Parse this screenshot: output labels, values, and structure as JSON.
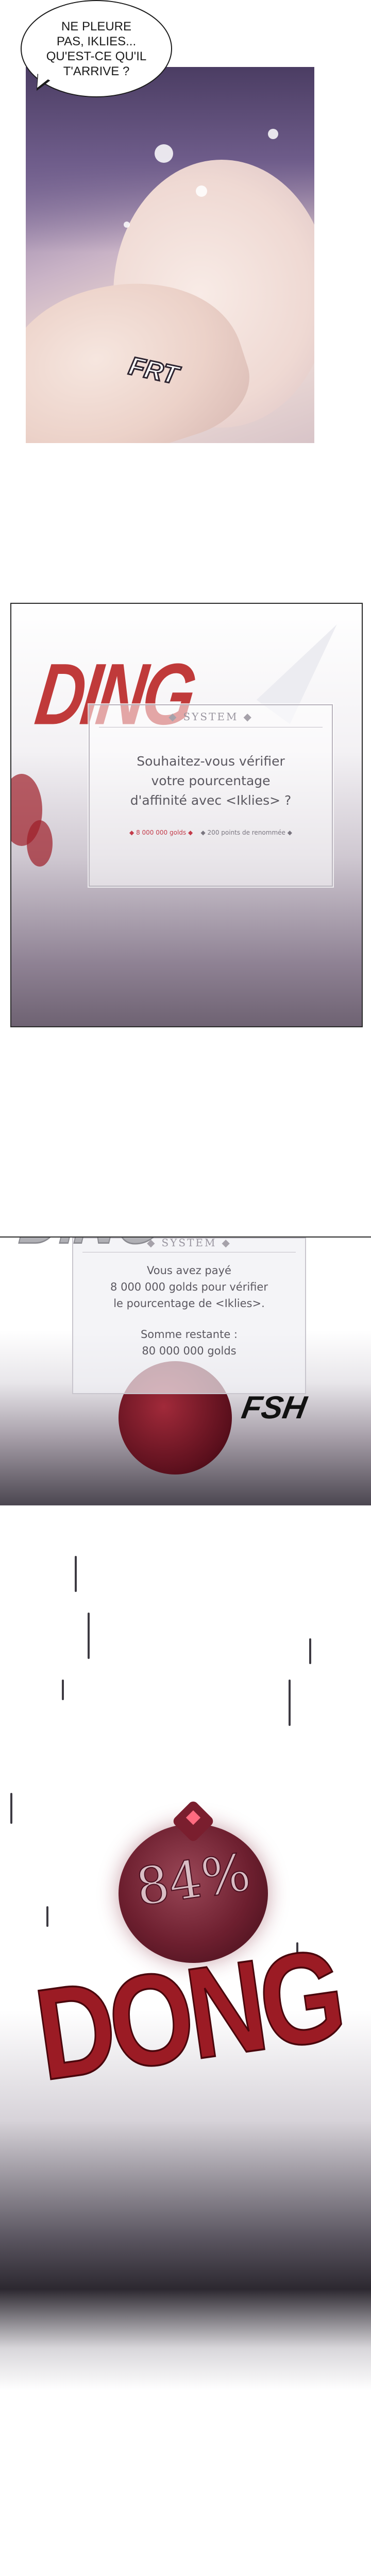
{
  "speech_bubble": {
    "lines": [
      "NE PLEURE",
      "PAS, IKLIES...",
      "QU'EST-CE QU'IL",
      "T'ARRIVE ?"
    ]
  },
  "sfx": {
    "frt": "FRT",
    "ding_1": "DING",
    "ding_2": "DING",
    "fsh": "FSH",
    "dong": "DONG"
  },
  "system_window_1": {
    "header": "SYSTEM",
    "text_lines": [
      "Souhaitez-vous vérifier",
      "votre pourcentage",
      "d'affinité avec <Iklies> ?"
    ],
    "cost_gold": "8 000 000",
    "cost_gold_unit": "golds",
    "cost_points": "200",
    "cost_points_unit": "points de renommée"
  },
  "system_window_2": {
    "header": "SYSTEM",
    "text_lines": [
      "Vous avez payé",
      "8 000 000 golds pour vérifier",
      "le pourcentage de <Iklies>."
    ],
    "remaining_label": "Somme restante :",
    "remaining_value": "80 000 000",
    "remaining_unit": "golds"
  },
  "affinity": {
    "value": "84%"
  },
  "colors": {
    "ding_red": "#c03a3a",
    "dong_red": "#9b1b24",
    "orb": "#6d1f2f",
    "cost_red": "#c33b4a"
  }
}
